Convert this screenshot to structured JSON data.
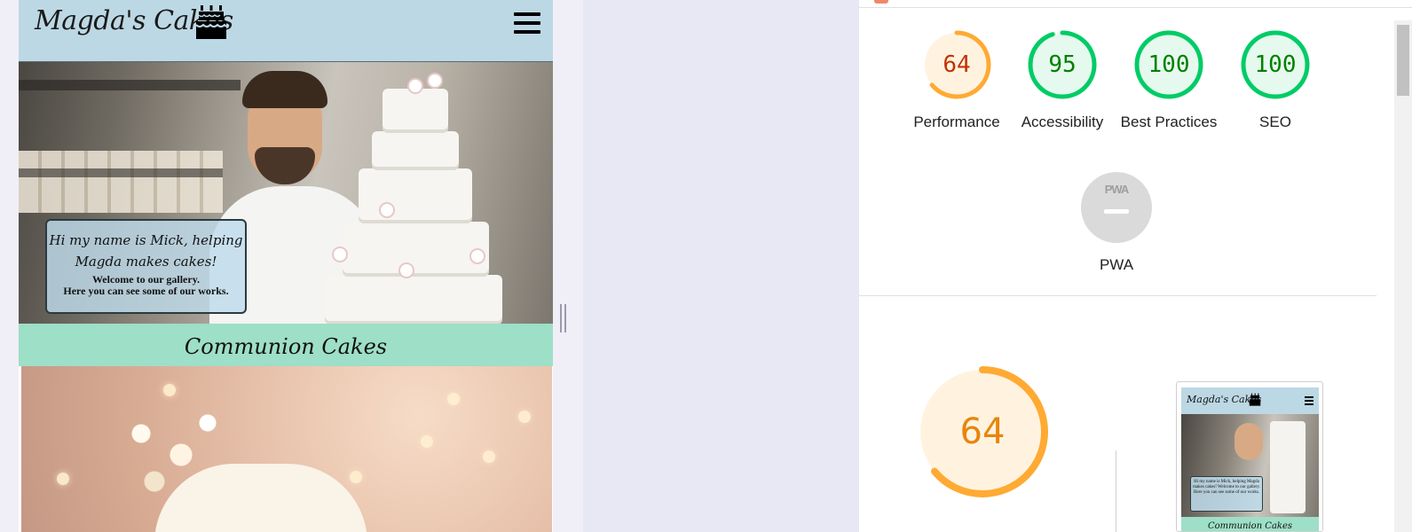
{
  "site": {
    "logo": "Magda's Cakes",
    "hero_caption_line1": "Hi my name is Mick, helping Magda makes cakes!",
    "hero_caption_line2a": "Welcome to our gallery.",
    "hero_caption_line2b": "Here you can see some of our works.",
    "section_title": "Communion Cakes"
  },
  "report": {
    "gauges": [
      {
        "label": "Performance",
        "score": 64,
        "color": "#fa3",
        "text_color": "#c33300",
        "bg": "#fff3e0"
      },
      {
        "label": "Accessibility",
        "score": 95,
        "color": "#0c6",
        "text_color": "#008000",
        "bg": "#e6f9ee"
      },
      {
        "label": "Best Practices",
        "score": 100,
        "color": "#0c6",
        "text_color": "#008000",
        "bg": "#e6f9ee"
      },
      {
        "label": "SEO",
        "score": 100,
        "color": "#0c6",
        "text_color": "#008000",
        "bg": "#e6f9ee"
      }
    ],
    "pwa": {
      "label": "PWA",
      "badge": "PWA"
    },
    "big_score": 64,
    "thumb_logo": "Magda's Cakes",
    "thumb_caption": "Hi my name is Mick, helping Magda makes cakes! Welcome to our gallery. Here you can see some of our works.",
    "thumb_section_title": "Communion Cakes"
  },
  "icons": [
    "birthday-cake-icon",
    "hamburger-menu-icon",
    "pwa-icon"
  ],
  "colors": {
    "header_bg": "#bcd8e4",
    "section_bar_bg": "#9ddfc7",
    "average_orange": "#fa3",
    "pass_green": "#0c6"
  }
}
